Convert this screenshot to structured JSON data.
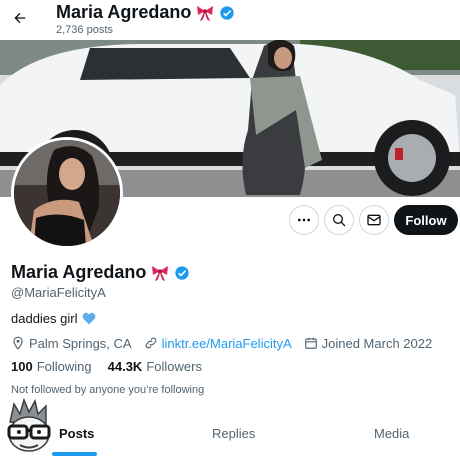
{
  "header": {
    "title": "Maria Agredano",
    "posts_count": "2,736 posts"
  },
  "actions": {
    "follow_label": "Follow"
  },
  "profile": {
    "name": "Maria Agredano",
    "handle": "@MariaFelicityA",
    "bio": "daddies girl",
    "location": "Palm Springs, CA",
    "link": "linktr.ee/MariaFelicityA",
    "joined": "Joined March 2022",
    "following_count": "100",
    "following_label": "Following",
    "followers_count": "44.3K",
    "followers_label": "Followers",
    "not_followed_text": "Not followed by anyone you’re following"
  },
  "tabs": [
    {
      "label": "Posts",
      "active": true
    },
    {
      "label": "Replies",
      "active": false
    },
    {
      "label": "Media",
      "active": false
    }
  ],
  "icons": [
    "back-arrow-icon",
    "ribbon-icon",
    "verified-badge-icon",
    "more-icon",
    "search-icon",
    "message-icon",
    "location-icon",
    "link-icon",
    "calendar-icon",
    "blue-heart-icon"
  ],
  "colors": {
    "accent": "#1d9bf0",
    "text_primary": "#0f1419",
    "text_secondary": "#536471",
    "follow_button": "#0f1419"
  }
}
